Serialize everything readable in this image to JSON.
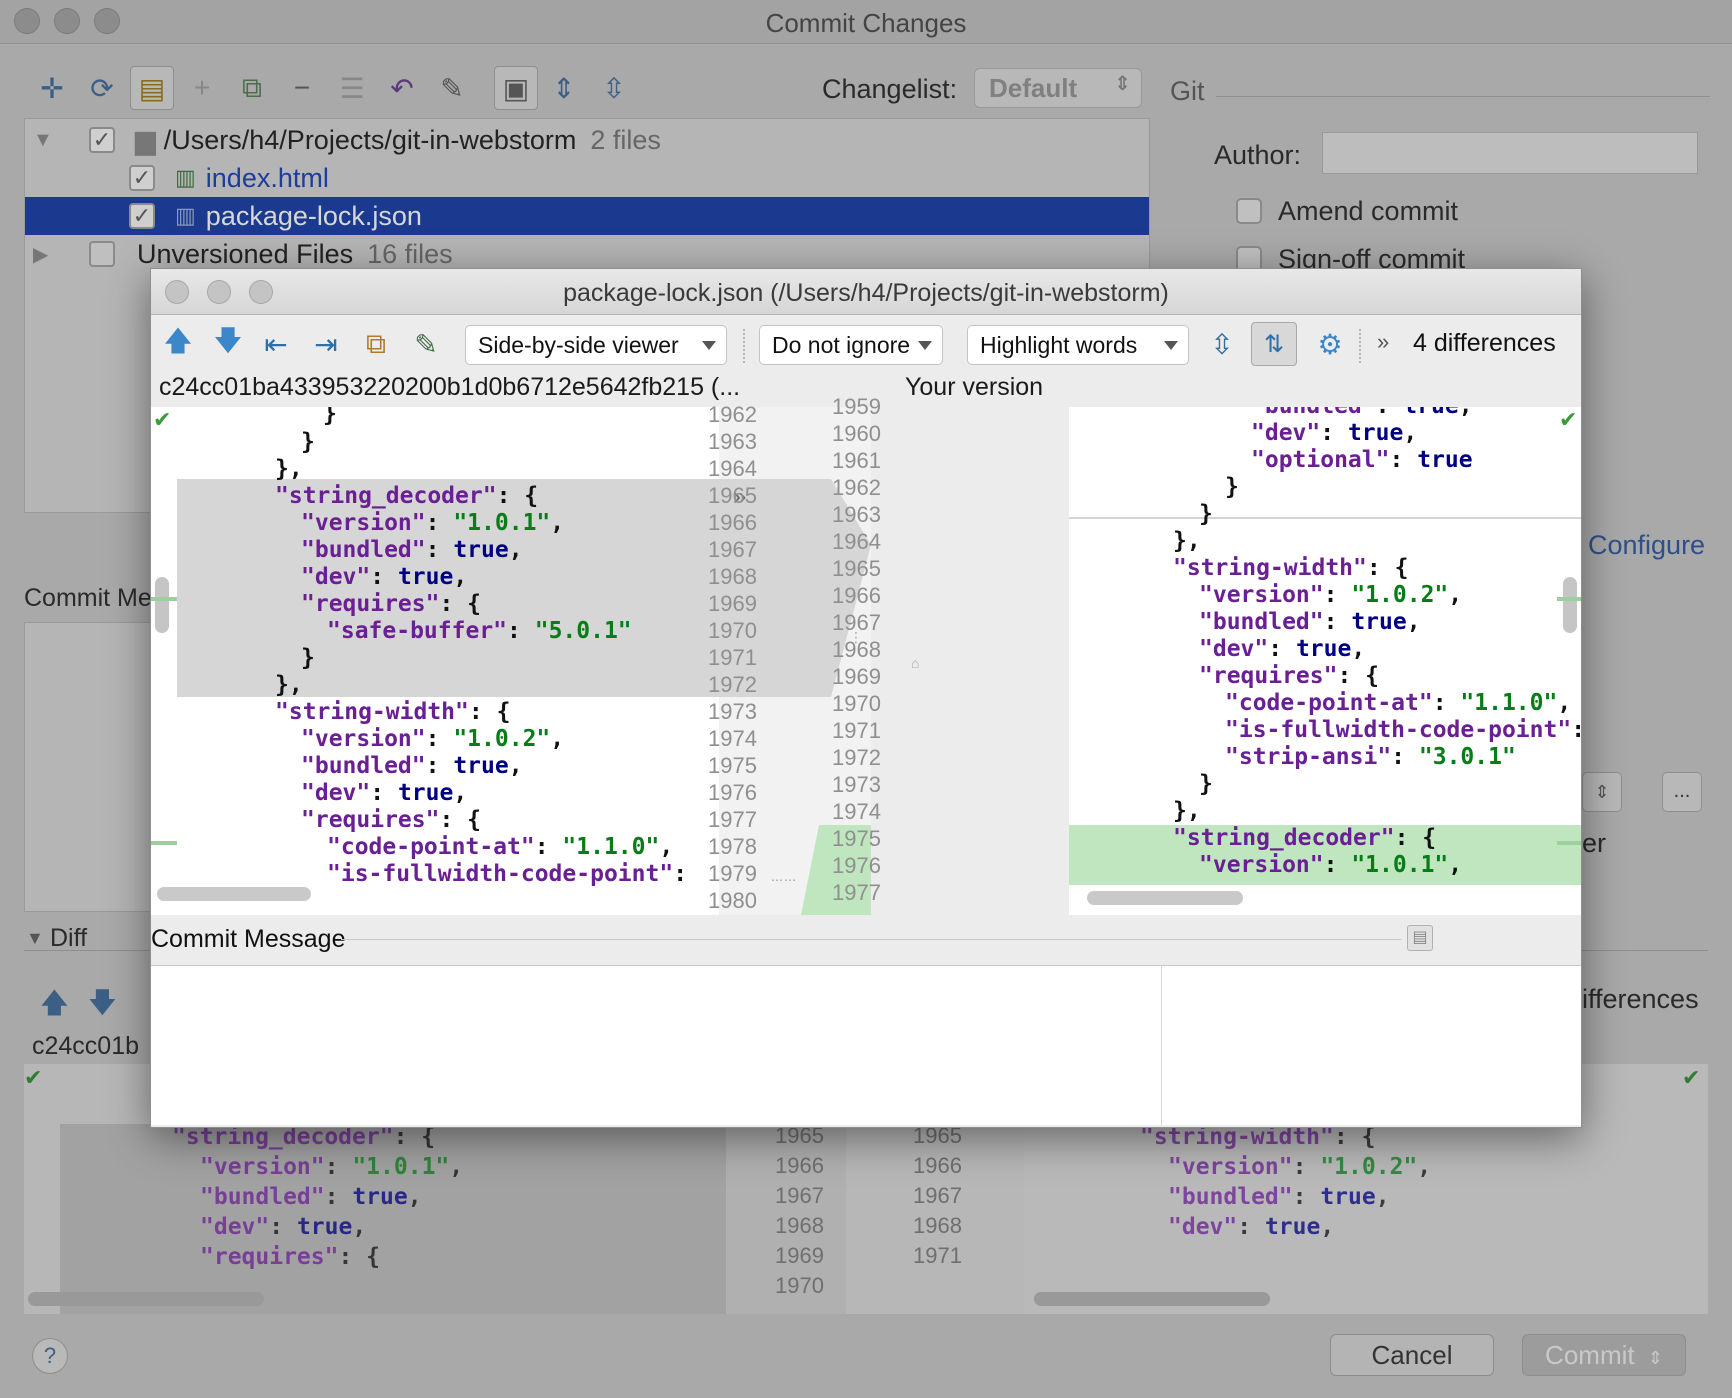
{
  "window": {
    "title": "Commit Changes"
  },
  "changelist": {
    "label": "Changelist:",
    "value": "Default"
  },
  "vcs": {
    "label": "Git"
  },
  "tree": {
    "root_path": "/Users/h4/Projects/git-in-webstorm",
    "root_count": "2 files",
    "files": [
      "index.html",
      "package-lock.json"
    ],
    "unversioned_label": "Unversioned Files",
    "unversioned_count": "16 files"
  },
  "options": {
    "author_label": "Author:",
    "amend": "Amend commit",
    "signoff": "Sign-off commit",
    "configure": "Configure",
    "partial_er": "er",
    "ellipsis": "..."
  },
  "bg": {
    "commit_message_label": "Commit Me",
    "diff_label": "Diff",
    "hash_partial": "c24cc01b",
    "differences_partial": "ifferences",
    "cancel": "Cancel",
    "commit": "Commit",
    "help": "?"
  },
  "dialog": {
    "title": "package-lock.json (/Users/h4/Projects/git-in-webstorm)",
    "viewer": "Side-by-side viewer",
    "ignore": "Do not ignore",
    "highlight": "Highlight words",
    "more": "»",
    "differences": "4 differences",
    "left_header": "c24cc01ba433953220200b1d0b6712e5642fb215 (...",
    "right_header": "Your version",
    "commit_message_label": "Commit Message"
  },
  "left_numbers": [
    "1962",
    "1963",
    "1964",
    "1965",
    "1966",
    "1967",
    "1968",
    "1969",
    "1970",
    "1971",
    "1972",
    "1973",
    "1974",
    "1975",
    "1976",
    "1977",
    "1978",
    "1979",
    "1980"
  ],
  "right_numbers": [
    "1959",
    "1960",
    "1961",
    "1962",
    "1963",
    "1964",
    "1965",
    "1966",
    "1967",
    "1968",
    "1969",
    "1970",
    "1971",
    "1972",
    "1973",
    "1974",
    "1975",
    "1976",
    "1977"
  ],
  "bg_left_numbers": [
    "1965",
    "1966",
    "1967",
    "1968",
    "1969",
    "1970"
  ],
  "bg_right_numbers": [
    "1965",
    "1966",
    "1967",
    "1968",
    "1971"
  ],
  "colors": {
    "deleted_bg": "#d6d6d6",
    "added_bg": "#bfe6bf",
    "key": "#6a1f94",
    "string": "#067d17",
    "keyword": "#000080",
    "selection": "#1b3a8f"
  }
}
